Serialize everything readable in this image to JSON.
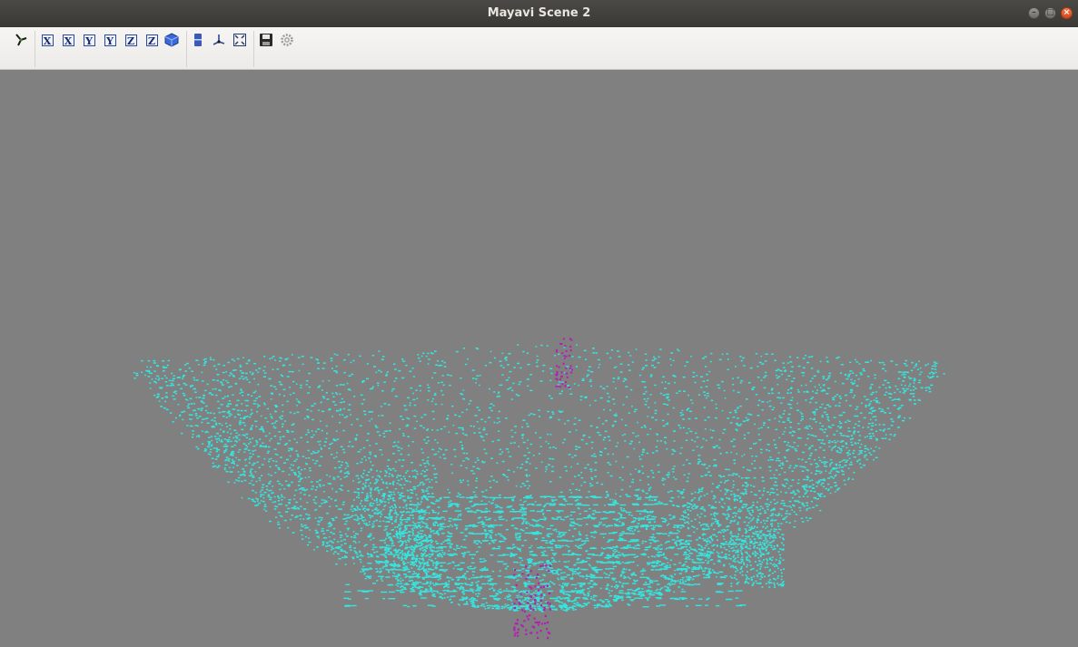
{
  "window": {
    "title": "Mayavi Scene 2"
  },
  "toolbar": {
    "buttons": [
      {
        "name": "view-isometric-icon",
        "kind": "icon"
      },
      {
        "name": "view-x-plus-icon",
        "label": "X"
      },
      {
        "name": "view-x-minus-icon",
        "label": "X"
      },
      {
        "name": "view-y-plus-icon",
        "label": "Y"
      },
      {
        "name": "view-y-minus-icon",
        "label": "Y"
      },
      {
        "name": "view-z-plus-icon",
        "label": "Z"
      },
      {
        "name": "view-z-minus-icon",
        "label": "Z"
      },
      {
        "name": "parallel-projection-icon",
        "kind": "icon"
      },
      {
        "name": "toggle-axes-icon",
        "kind": "icon"
      },
      {
        "name": "toggle-orientation-icon",
        "kind": "icon"
      },
      {
        "name": "fullscreen-icon",
        "kind": "icon"
      },
      {
        "name": "save-icon",
        "kind": "icon"
      },
      {
        "name": "configure-icon",
        "kind": "icon"
      }
    ]
  },
  "scene": {
    "background_color": "#808080",
    "point_color_primary": "#33e6e0",
    "point_color_highlight": "#b31fb3"
  }
}
